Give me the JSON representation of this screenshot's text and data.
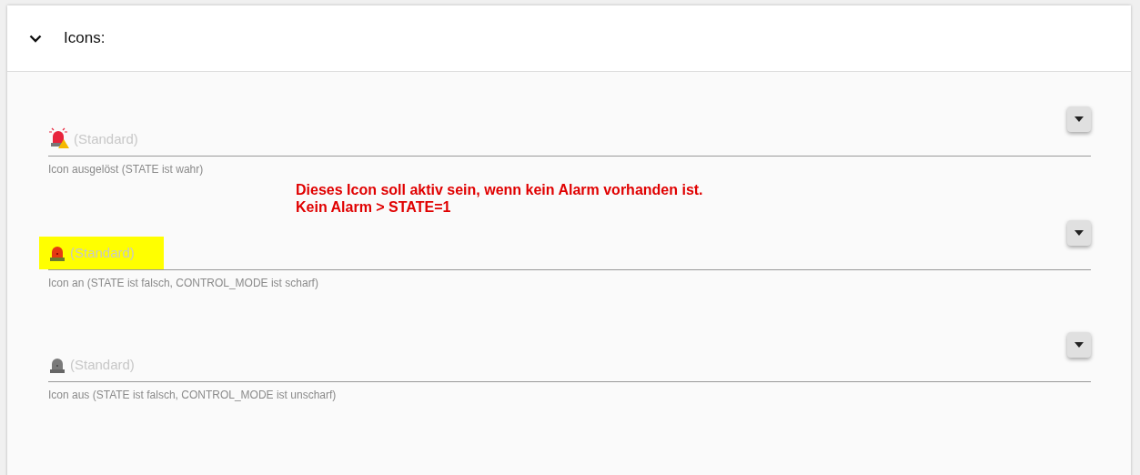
{
  "section": {
    "title": "Icons:",
    "expanded": true
  },
  "fields": [
    {
      "kind": "warning",
      "placeholder": "(Standard)",
      "helper": "Icon ausgelöst (STATE ist wahr)",
      "highlighted": false,
      "note": [
        "Dieses Icon soll aktiv sein, wenn kein Alarm vorhanden ist.",
        "Kein Alarm > STATE=1"
      ]
    },
    {
      "kind": "on",
      "placeholder": "(Standard)",
      "helper": "Icon an (STATE ist falsch, CONTROL_MODE ist scharf)",
      "highlighted": true
    },
    {
      "kind": "off",
      "placeholder": "(Standard)",
      "helper": "Icon aus (STATE ist falsch, CONTROL_MODE ist unscharf)",
      "highlighted": false
    }
  ]
}
